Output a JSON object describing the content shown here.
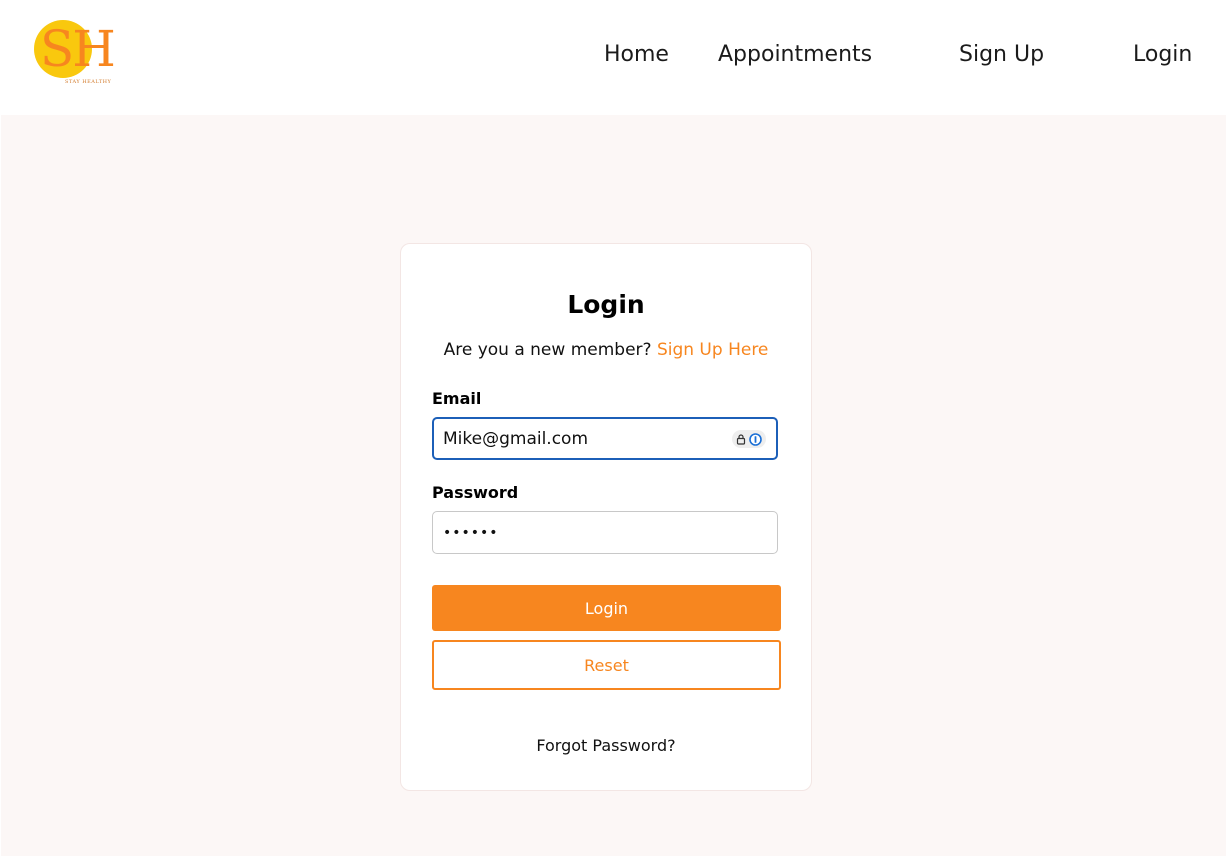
{
  "header": {
    "logo": {
      "letters": "SH",
      "tagline": "STAY HEALTHY"
    },
    "nav": {
      "home": "Home",
      "appointments": "Appointments",
      "signup": "Sign Up",
      "login": "Login"
    }
  },
  "login_card": {
    "title": "Login",
    "subtitle_prefix": "Are you a new member?",
    "signup_link": "Sign Up Here",
    "email_label": "Email",
    "email_value": "Mike@gmail.com",
    "password_label": "Password",
    "password_value": "••••••",
    "login_button": "Login",
    "reset_button": "Reset",
    "forgot_password": "Forgot Password?"
  },
  "colors": {
    "accent": "#f7861f",
    "logo_circle": "#f9c80e",
    "focus_border": "#1c5fb8",
    "page_background": "#fcf7f6"
  }
}
